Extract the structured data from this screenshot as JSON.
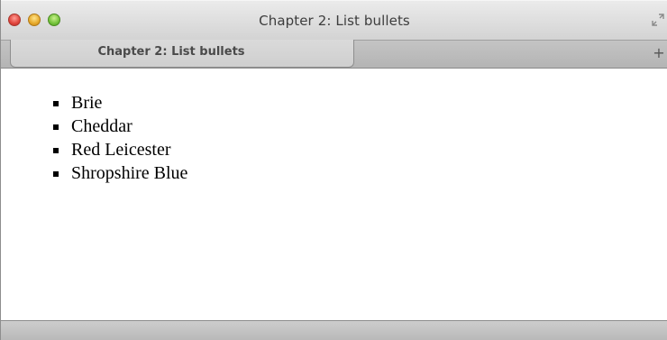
{
  "window": {
    "title": "Chapter 2: List bullets"
  },
  "tabs": [
    {
      "label": "Chapter 2: List bullets"
    }
  ],
  "new_tab_label": "+",
  "content": {
    "list_items": [
      {
        "label": "Brie"
      },
      {
        "label": "Cheddar"
      },
      {
        "label": "Red Leicester"
      },
      {
        "label": "Shropshire Blue"
      }
    ]
  },
  "colors": {
    "close": "#e0443c",
    "minimize": "#e6a92a",
    "zoom": "#73c23a"
  }
}
